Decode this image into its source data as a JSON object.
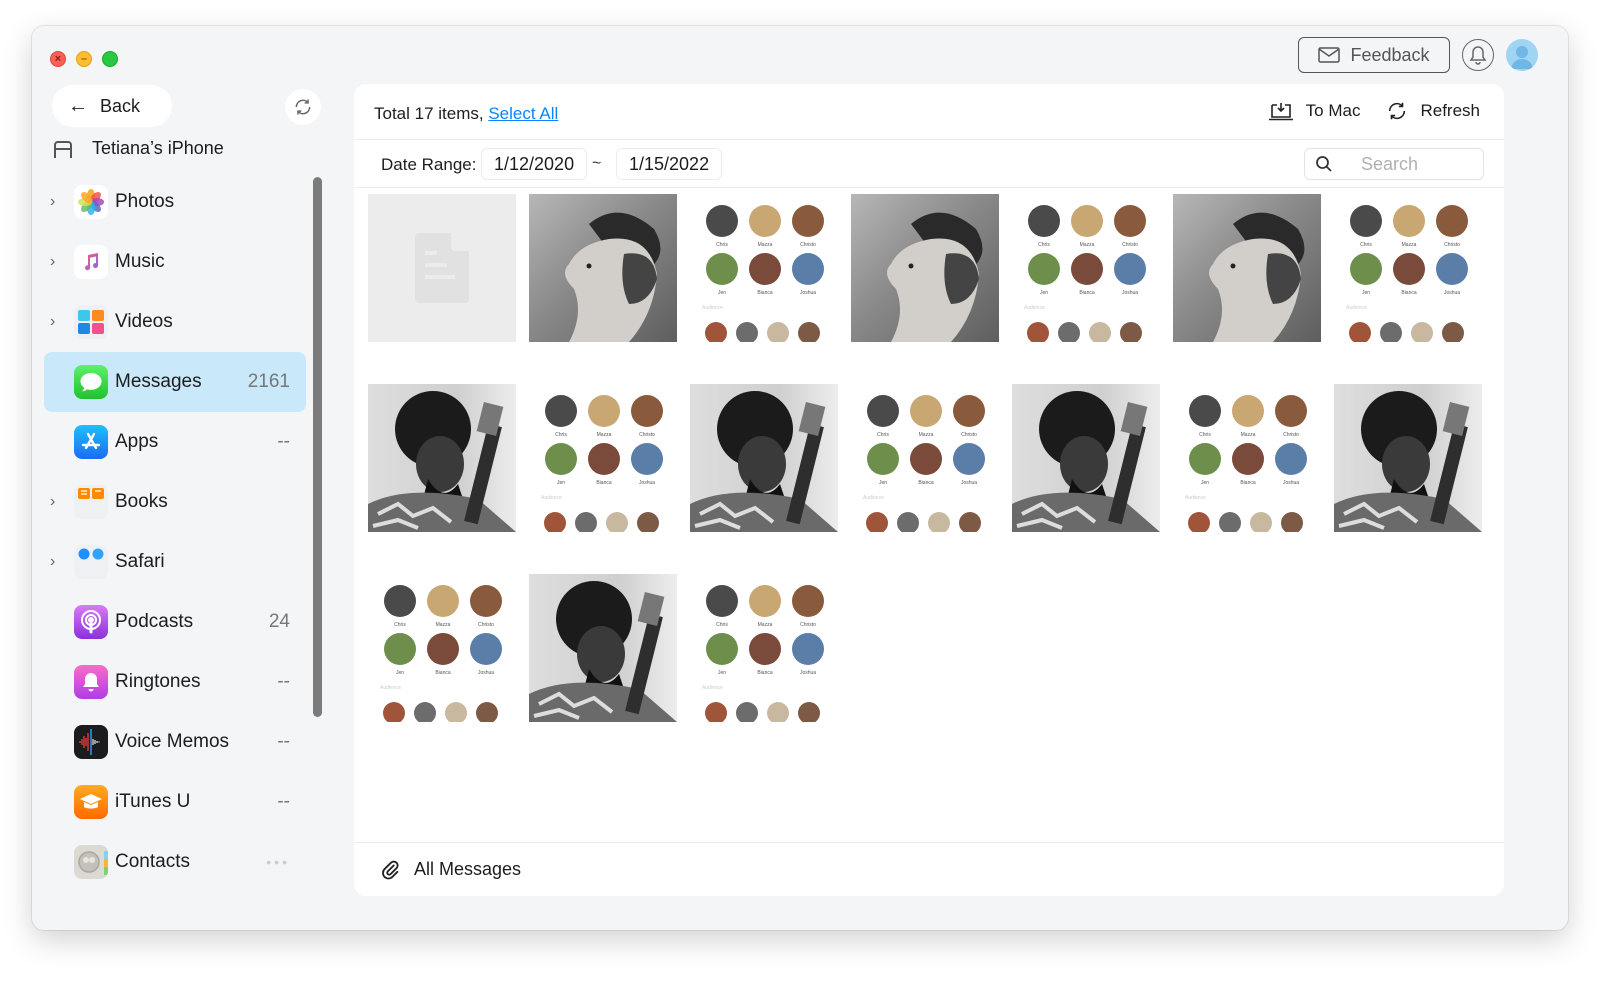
{
  "window": {
    "controls": [
      "close",
      "minimize",
      "zoom"
    ]
  },
  "sidebar": {
    "back_label": "Back",
    "device_name": "Tetiana’s iPhone",
    "items": [
      {
        "label": "Photos",
        "count": "",
        "expandable": true,
        "icon": "photos-icon"
      },
      {
        "label": "Music",
        "count": "",
        "expandable": true,
        "icon": "music-icon"
      },
      {
        "label": "Videos",
        "count": "",
        "expandable": true,
        "icon": "videos-icon"
      },
      {
        "label": "Messages",
        "count": "2161",
        "expandable": false,
        "icon": "messages-icon",
        "active": true
      },
      {
        "label": "Apps",
        "count": "--",
        "expandable": false,
        "icon": "app-store-icon"
      },
      {
        "label": "Books",
        "count": "",
        "expandable": true,
        "icon": "books-icon"
      },
      {
        "label": "Safari",
        "count": "",
        "expandable": true,
        "icon": "safari-icon"
      },
      {
        "label": "Podcasts",
        "count": "24",
        "expandable": false,
        "icon": "podcasts-icon"
      },
      {
        "label": "Ringtones",
        "count": "--",
        "expandable": false,
        "icon": "ringtones-icon"
      },
      {
        "label": "Voice Memos",
        "count": "--",
        "expandable": false,
        "icon": "voice-memos-icon"
      },
      {
        "label": "iTunes U",
        "count": "--",
        "expandable": false,
        "icon": "itunes-u-icon"
      },
      {
        "label": "Contacts",
        "count": "•••",
        "expandable": false,
        "icon": "contacts-icon"
      }
    ]
  },
  "header": {
    "feedback_label": "Feedback"
  },
  "toolbar": {
    "total_text": "Total 17 items,",
    "select_all": "Select All",
    "to_mac": "To Mac",
    "refresh": "Refresh"
  },
  "filter": {
    "date_range_label": "Date Range:",
    "date_from": "1/12/2020",
    "separator": "~",
    "date_to": "1/15/2022",
    "search_placeholder": "Search"
  },
  "grid": {
    "items": [
      {
        "type": "file"
      },
      {
        "type": "cap"
      },
      {
        "type": "contacts"
      },
      {
        "type": "cap"
      },
      {
        "type": "contacts"
      },
      {
        "type": "cap"
      },
      {
        "type": "contacts"
      },
      {
        "type": "guitar"
      },
      {
        "type": "contacts"
      },
      {
        "type": "guitar"
      },
      {
        "type": "contacts"
      },
      {
        "type": "guitar"
      },
      {
        "type": "contacts"
      },
      {
        "type": "guitar"
      },
      {
        "type": "contacts"
      },
      {
        "type": "guitar"
      },
      {
        "type": "contacts"
      }
    ],
    "contact_names": [
      "Chris",
      "Mazza",
      "Christo",
      "Jen",
      "Bianca",
      "Joshua"
    ],
    "section_label": "Audience"
  },
  "footer": {
    "label": "All Messages"
  },
  "colors": {
    "accent": "#0a84ff",
    "active_bg": "#c9e8f9",
    "window_bg": "#f4f5f7"
  }
}
